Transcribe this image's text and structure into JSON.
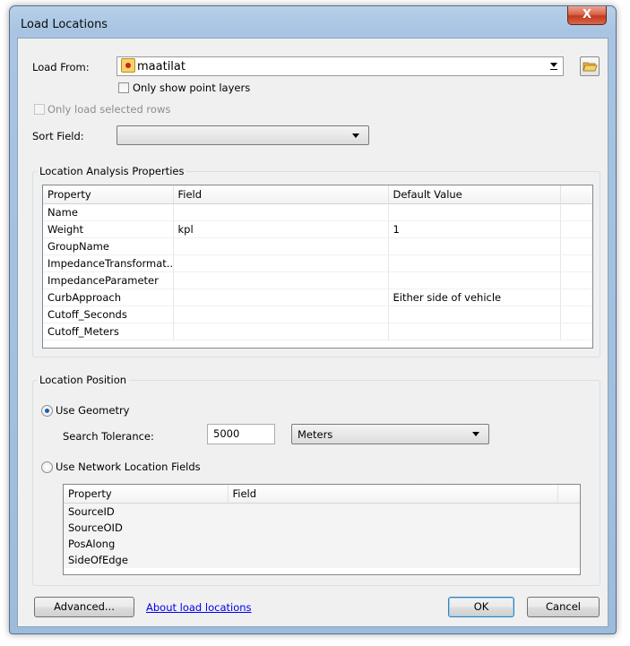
{
  "window": {
    "title": "Load Locations",
    "close_glyph": "X"
  },
  "load_from": {
    "label": "Load From:",
    "value": "maatilat",
    "layer_icon": "point-layer-icon",
    "browse_icon": "open-folder-icon",
    "only_point_layers_label": "Only show point layers"
  },
  "only_selected_rows_label": "Only load selected rows",
  "sort_field": {
    "label": "Sort Field:",
    "value": ""
  },
  "analysis": {
    "group_title": "Location Analysis Properties",
    "columns": [
      "Property",
      "Field",
      "Default Value"
    ],
    "rows": [
      [
        "Name",
        "",
        ""
      ],
      [
        "Weight",
        "kpl",
        "1"
      ],
      [
        "GroupName",
        "",
        ""
      ],
      [
        "ImpedanceTransformat...",
        "",
        ""
      ],
      [
        "ImpedanceParameter",
        "",
        ""
      ],
      [
        "CurbApproach",
        "",
        "Either side of vehicle"
      ],
      [
        "Cutoff_Seconds",
        "",
        ""
      ],
      [
        "Cutoff_Meters",
        "",
        ""
      ]
    ]
  },
  "position": {
    "group_title": "Location Position",
    "use_geometry_label": "Use Geometry",
    "search_tolerance_label": "Search Tolerance:",
    "search_tolerance_value": "5000",
    "units_value": "Meters",
    "use_network_fields_label": "Use Network Location Fields",
    "columns": [
      "Property",
      "Field"
    ],
    "rows": [
      [
        "SourceID",
        ""
      ],
      [
        "SourceOID",
        ""
      ],
      [
        "PosAlong",
        ""
      ],
      [
        "SideOfEdge",
        ""
      ]
    ]
  },
  "footer": {
    "advanced_label": "Advanced...",
    "about_link": "About load locations",
    "ok_label": "OK",
    "cancel_label": "Cancel"
  },
  "colors": {
    "link": "#0000ee",
    "selected_radio": "#1b5fb0",
    "title_bar": "#a8c4e2"
  }
}
